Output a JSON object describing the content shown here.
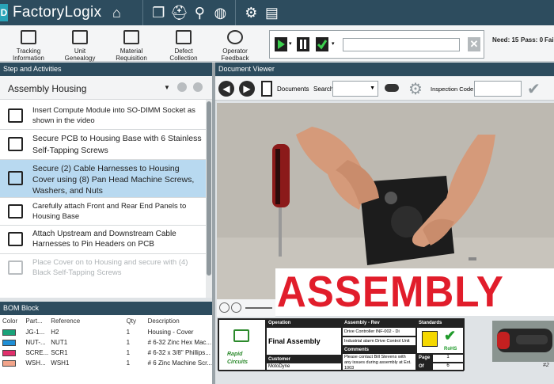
{
  "app": {
    "title": "FactoryLogix",
    "logo_letter": "D"
  },
  "ribbon": {
    "items": [
      "Tracking Information",
      "Unit Genealogy",
      "Material Requisition",
      "Defect Collection",
      "Operator Feedback"
    ],
    "need_label": "Need: 15",
    "pass_label": "Pass: 0",
    "fail_label": "Fail"
  },
  "steps_panel": {
    "header": "Step and Activities",
    "assembly_select": "Assembly Housing",
    "steps": [
      "Insert Compute Module into SO-DIMM Socket as shown in the video",
      "Secure PCB to Housing Base with 6 Stainless Self-Tapping Screws",
      "Secure (2) Cable Harnesses to Housing Cover using (8) Pan Head Machine Screws, Washers, and Nuts",
      "Carefully attach Front and Rear End Panels to Housing Base",
      "Attach Upstream and Downstream Cable Harnesses to Pin Headers on PCB",
      "Place Cover on to Housing and secure with (4) Black Self-Tapping Screws"
    ]
  },
  "bom": {
    "header": "BOM Block",
    "columns": [
      "Color",
      "Part...",
      "Reference",
      "Qty",
      "Description"
    ],
    "rows": [
      {
        "color": "#1aa37a",
        "part": "JG-1...",
        "ref": "H2",
        "qty": "1",
        "desc": "Housing - Cover"
      },
      {
        "color": "#1f8fd6",
        "part": "NUT-...",
        "ref": "NUT1",
        "qty": "1",
        "desc": "# 6-32 Zinc Hex Mac..."
      },
      {
        "color": "#e0306c",
        "part": "SCRE...",
        "ref": "SCR1",
        "qty": "1",
        "desc": "# 6-32 x 3/8\" Phillips..."
      },
      {
        "color": "#f2a48a",
        "part": "WSH...",
        "ref": "WSH1",
        "qty": "1",
        "desc": "# 6 Zinc Machine Scr..."
      }
    ]
  },
  "doc_viewer": {
    "header": "Document Viewer",
    "documents_label": "Documents",
    "search_label": "Search:",
    "inspection_label": "Inspection Code",
    "banner": "ASSEMBLY"
  },
  "sheet": {
    "operation_hd": "Operation",
    "operation": "Final Assembly",
    "assembly_rev_hd": "Assembly - Rev",
    "assembly_rev_1": "Drive Controller INF-002 - Di",
    "assembly_rev_2": "Industrial alarm Drive Control Unit",
    "comments_hd": "Comments",
    "comments": "Please contact Bill Stevens with any issues during assembly at Ext. 1003",
    "customer_hd": "Customer",
    "customer": "MotoDyne",
    "standards_hd": "Standards",
    "page_label": "Page",
    "page_num": "1",
    "of_label": "Of",
    "page_total": "6",
    "company_1": "Rapid",
    "company_2": "Circuits",
    "rohs": "RoHS"
  },
  "thumb_caption": "#2"
}
